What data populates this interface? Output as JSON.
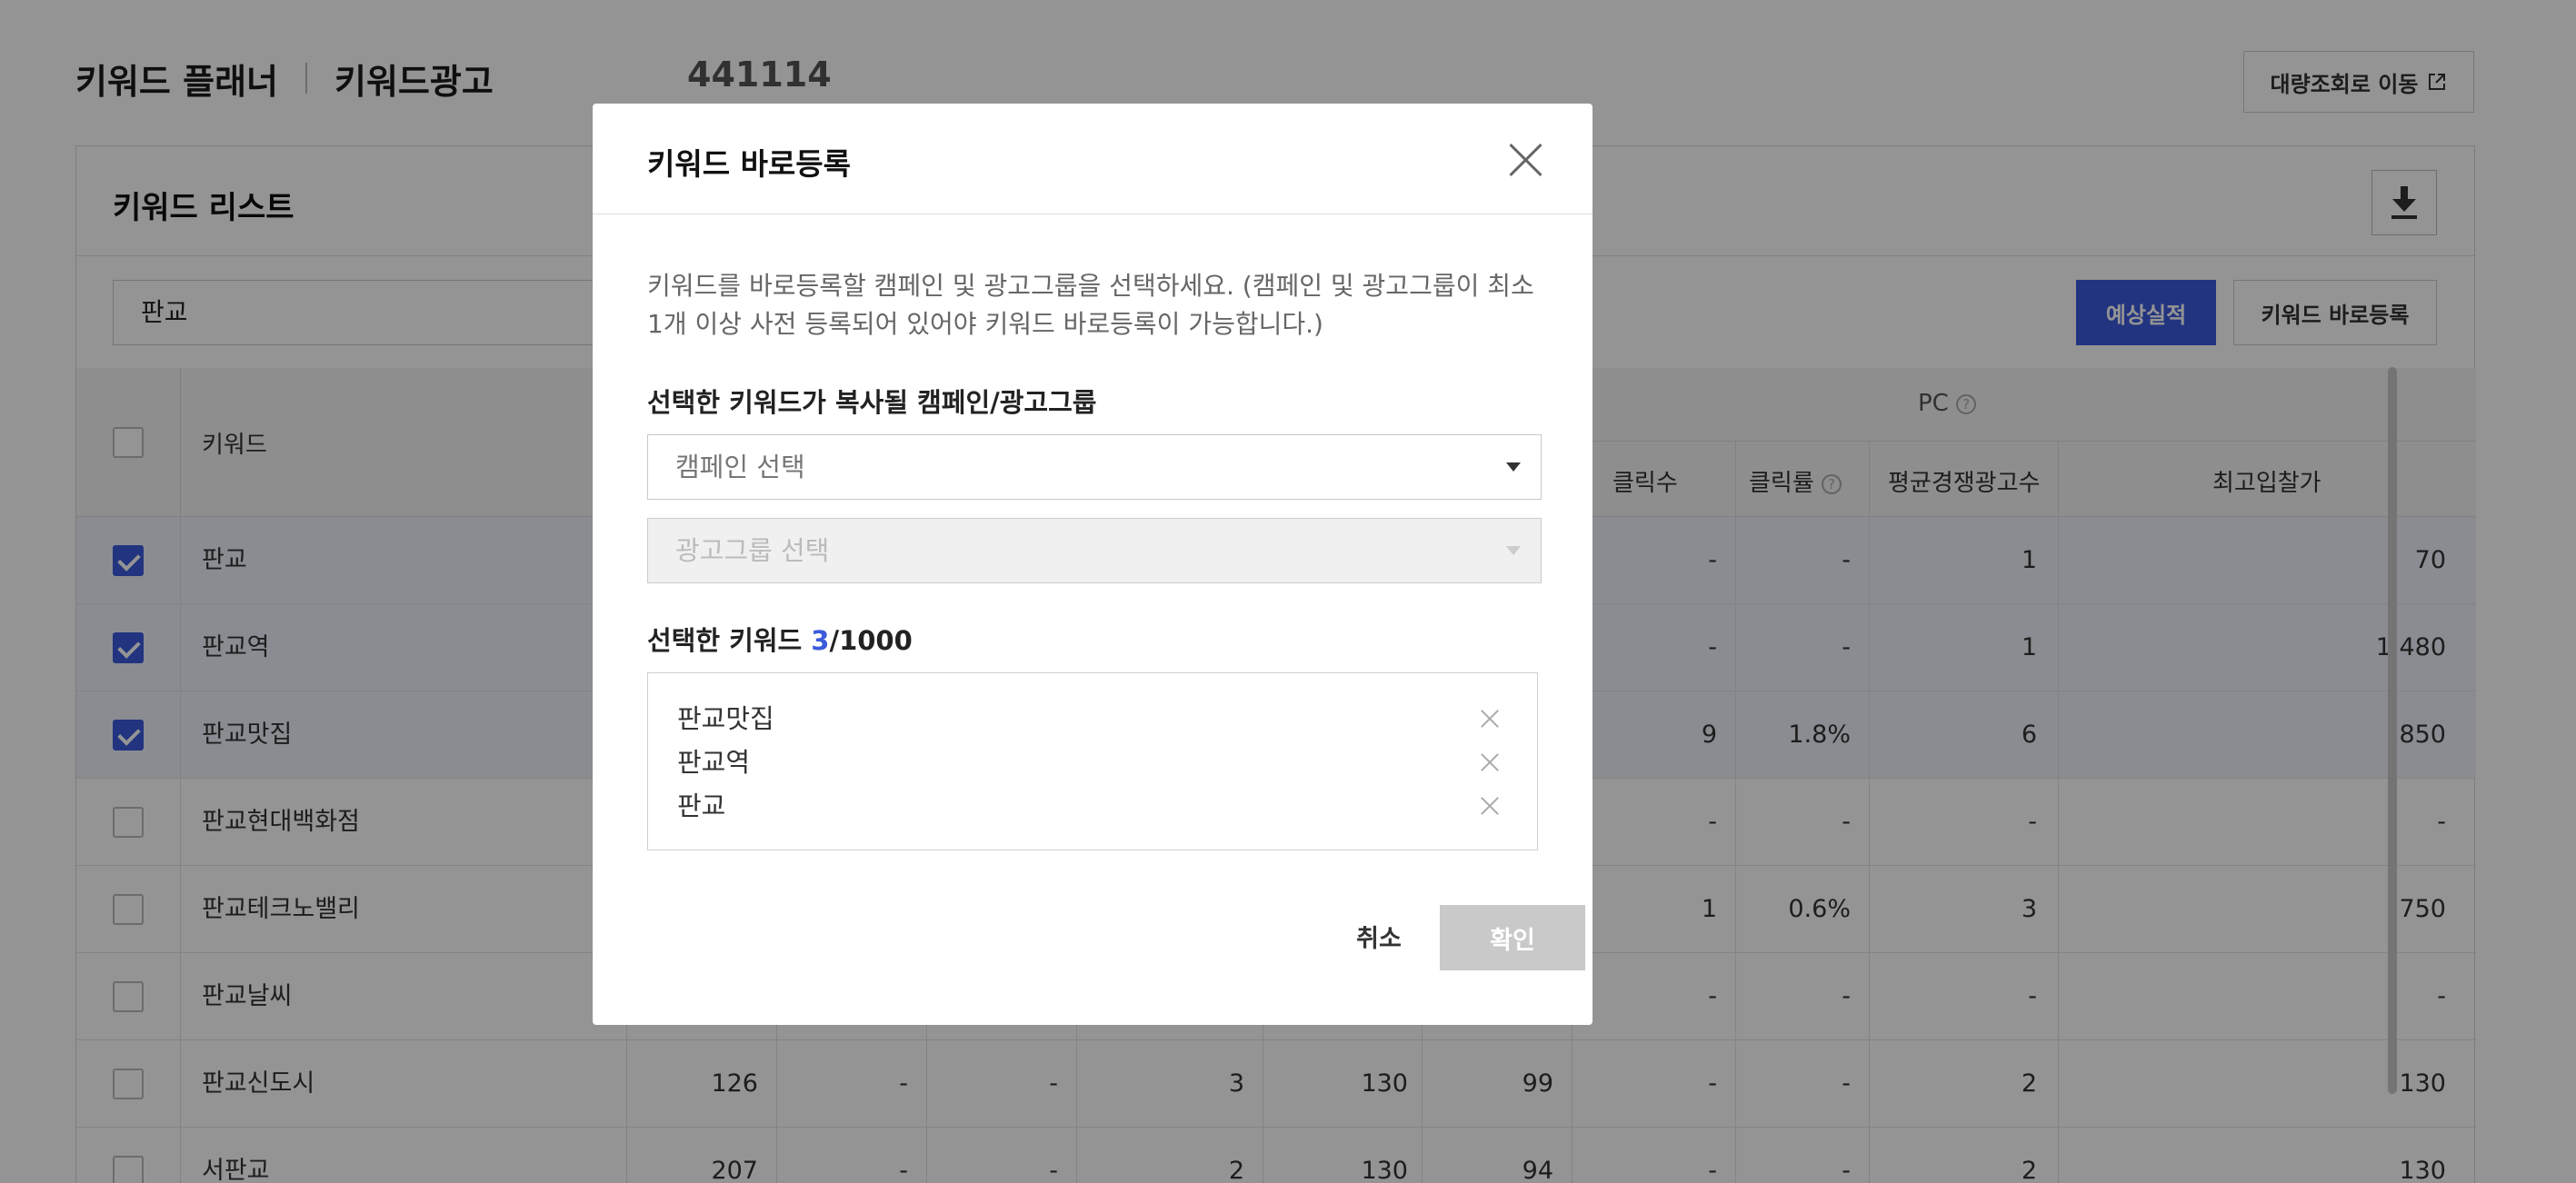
{
  "header": {
    "app_title": "키워드 플래너",
    "tab": "키워드광고",
    "account_id": "441114",
    "bulk_button": "대량조회로 이동"
  },
  "panel": {
    "title": "키워드 리스트",
    "search_value": "판교",
    "forecast_button": "예상실적",
    "register_button": "키워드 바로등록"
  },
  "table": {
    "col_keyword": "키워드",
    "group_pc": "PC",
    "col_clicks": "클릭수",
    "col_ctr": "클릭률",
    "col_competition": "평균경쟁광고수",
    "col_max_bid": "최고입찰가",
    "rows": [
      {
        "keyword": "판교",
        "checked": true,
        "c1": "",
        "c2": "",
        "c3": "",
        "c4": "",
        "c5": "",
        "c6": "",
        "clicks": "-",
        "ctr": "-",
        "comp": "1",
        "bid": "70"
      },
      {
        "keyword": "판교역",
        "checked": true,
        "c1": "",
        "c2": "",
        "c3": "",
        "c4": "",
        "c5": "",
        "c6": "",
        "clicks": "-",
        "ctr": "-",
        "comp": "1",
        "bid": "1,480"
      },
      {
        "keyword": "판교맛집",
        "checked": true,
        "c1": "",
        "c2": "",
        "c3": "",
        "c4": "",
        "c5": "",
        "c6": "",
        "clicks": "9",
        "ctr": "1.8%",
        "comp": "6",
        "bid": "850"
      },
      {
        "keyword": "판교현대백화점",
        "checked": false,
        "c1": "",
        "c2": "",
        "c3": "",
        "c4": "",
        "c5": "",
        "c6": "",
        "clicks": "-",
        "ctr": "-",
        "comp": "-",
        "bid": "-"
      },
      {
        "keyword": "판교테크노밸리",
        "checked": false,
        "c1": "",
        "c2": "",
        "c3": "",
        "c4": "",
        "c5": "",
        "c6": "",
        "clicks": "1",
        "ctr": "0.6%",
        "comp": "3",
        "bid": "750"
      },
      {
        "keyword": "판교날씨",
        "checked": false,
        "c1": "",
        "c2": "",
        "c3": "",
        "c4": "",
        "c5": "",
        "c6": "",
        "clicks": "-",
        "ctr": "-",
        "comp": "-",
        "bid": "-"
      },
      {
        "keyword": "판교신도시",
        "checked": false,
        "c1": "126",
        "c2": "-",
        "c3": "-",
        "c4": "3",
        "c5": "130",
        "c6": "99",
        "clicks": "-",
        "ctr": "-",
        "comp": "2",
        "bid": "130"
      },
      {
        "keyword": "서판교",
        "checked": false,
        "c1": "207",
        "c2": "-",
        "c3": "-",
        "c4": "2",
        "c5": "130",
        "c6": "94",
        "clicks": "-",
        "ctr": "-",
        "comp": "2",
        "bid": "130"
      }
    ]
  },
  "modal": {
    "title": "키워드 바로등록",
    "description": "키워드를 바로등록할 캠페인 및 광고그룹을 선택하세요. (캠페인 및 광고그룹이 최소 1개 이상 사전 등록되어 있어야 키워드 바로등록이 가능합니다.)",
    "target_label": "선택한 키워드가 복사될 캠페인/광고그룹",
    "campaign_placeholder": "캠페인 선택",
    "adgroup_placeholder": "광고그룹 선택",
    "selected_label": "선택한 키워드",
    "selected_count": "3",
    "selected_max": "/1000",
    "selected_keywords": [
      "판교맛집",
      "판교역",
      "판교"
    ],
    "cancel_button": "취소",
    "confirm_button": "확인"
  },
  "colors": {
    "accent": "#3b5bdb",
    "disabled_button": "#c9c9c9",
    "overlay": "rgba(0,0,0,0.42)"
  }
}
